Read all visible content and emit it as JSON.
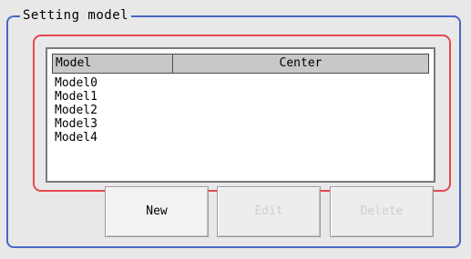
{
  "group": {
    "title": "Setting model"
  },
  "list": {
    "columns": [
      "Model",
      "Center"
    ],
    "rows": [
      {
        "model": "Model0",
        "center": ""
      },
      {
        "model": "Model1",
        "center": ""
      },
      {
        "model": "Model2",
        "center": ""
      },
      {
        "model": "Model3",
        "center": ""
      },
      {
        "model": "Model4",
        "center": ""
      }
    ]
  },
  "buttons": {
    "new": "New",
    "edit": "Edit",
    "delete": "Delete"
  },
  "colors": {
    "group_border": "#4a67c6",
    "highlight_border": "#e8474f"
  }
}
